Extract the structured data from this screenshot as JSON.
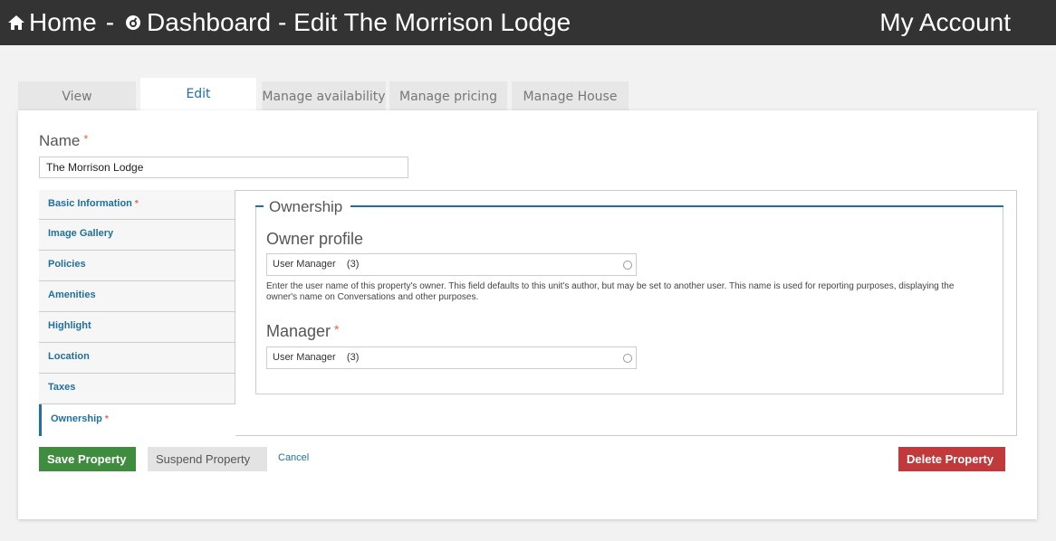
{
  "header": {
    "home_label": "Home",
    "separator": "-",
    "dashboard_label": "Dashboard",
    "page_title": "- Edit The Morrison Lodge",
    "account_label": "My Account"
  },
  "tabs": [
    {
      "label": "View"
    },
    {
      "label": "Edit"
    },
    {
      "label": "Manage availability"
    },
    {
      "label": "Manage pricing"
    },
    {
      "label": "Manage House"
    }
  ],
  "form": {
    "name_label": "Name",
    "required_mark": "*",
    "name_value": "The Morrison Lodge",
    "vertical_tabs": [
      {
        "label": "Basic Information",
        "required": "*"
      },
      {
        "label": "Image Gallery",
        "required": ""
      },
      {
        "label": "Policies",
        "required": ""
      },
      {
        "label": "Amenities",
        "required": ""
      },
      {
        "label": "Highlight",
        "required": ""
      },
      {
        "label": "Location",
        "required": ""
      },
      {
        "label": "Taxes",
        "required": ""
      },
      {
        "label": "Ownership",
        "required": "*"
      }
    ],
    "ownership": {
      "legend": "Ownership",
      "owner_label": "Owner profile",
      "owner_value": "User Manager    (3)",
      "owner_help": "Enter the user name of this property's owner. This field defaults to this unit's author, but may be set to another user. This name is used for reporting purposes, displaying the owner's name on Conversations and other purposes.",
      "manager_label": "Manager",
      "manager_value": "User Manager    (3)"
    }
  },
  "actions": {
    "save": "Save Property",
    "suspend": "Suspend Property",
    "cancel": "Cancel",
    "delete": "Delete Property"
  },
  "colors": {
    "accent": "#1f6f9f",
    "save": "#3f8c3f",
    "delete": "#c0393b",
    "required": "#e0693c"
  }
}
